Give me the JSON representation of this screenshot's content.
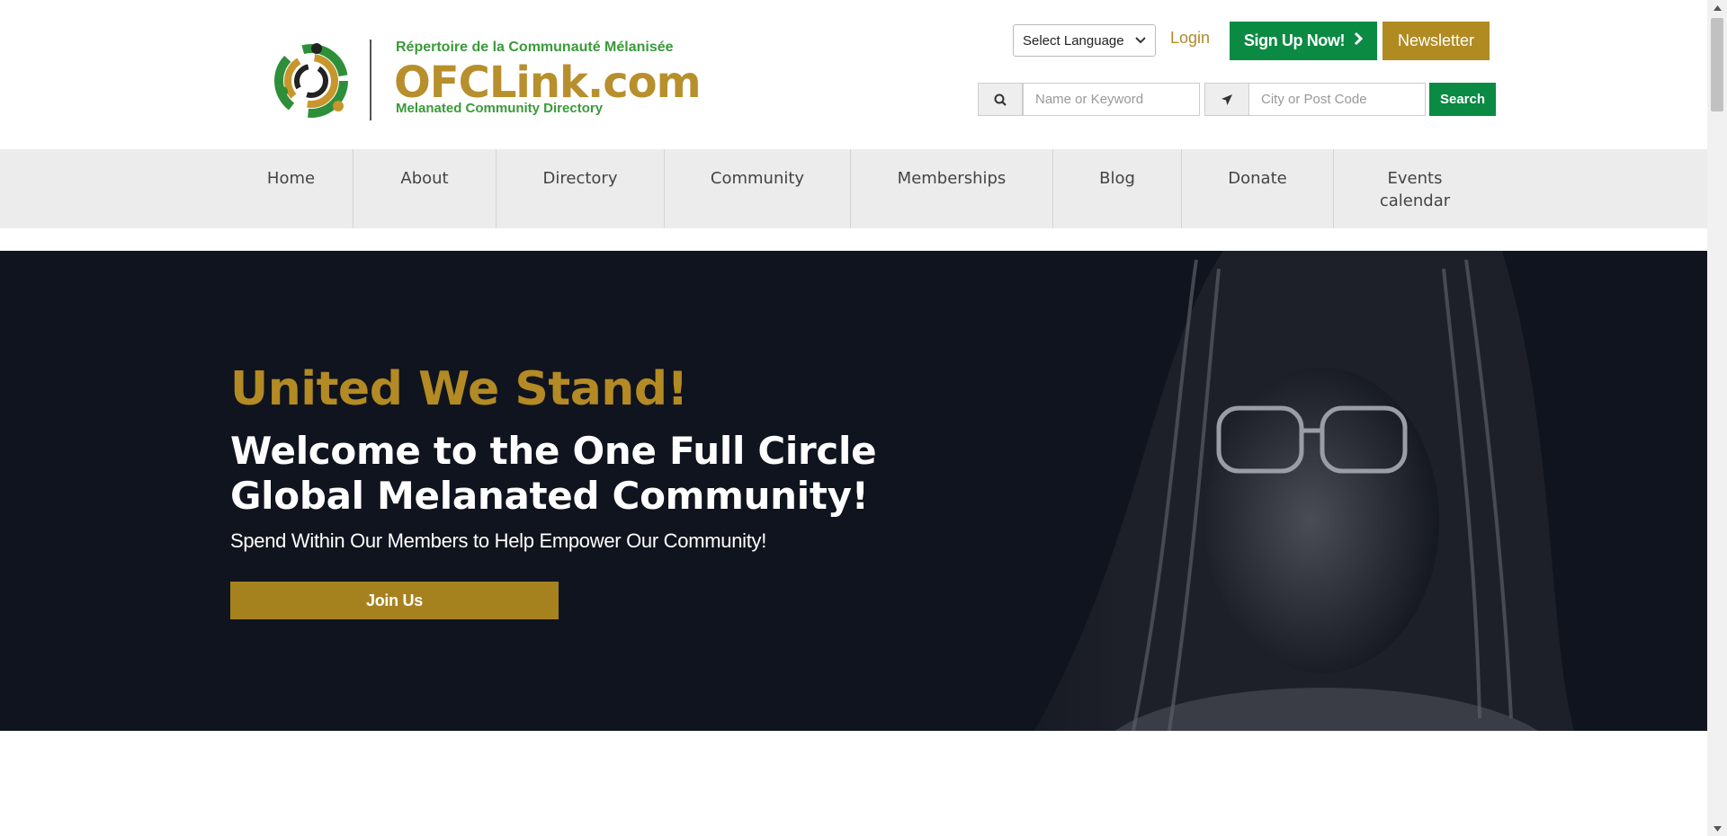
{
  "header": {
    "logo": {
      "top_text": "Répertoire de la Communauté Mélanisée",
      "main_text": "OFCLink.com",
      "bottom_text": "Melanated Community Directory"
    },
    "language_select": {
      "value": "Select Language"
    },
    "login_label": "Login",
    "signup_label": "Sign Up Now!",
    "newsletter_label": "Newsletter",
    "search": {
      "keyword_placeholder": "Name or Keyword",
      "location_placeholder": "City or Post Code",
      "button_label": "Search"
    }
  },
  "nav": {
    "items": [
      {
        "label": "Home"
      },
      {
        "label": "About"
      },
      {
        "label": "Directory"
      },
      {
        "label": "Community"
      },
      {
        "label": "Memberships"
      },
      {
        "label": "Blog"
      },
      {
        "label": "Donate"
      },
      {
        "label": "Events\ncalendar"
      }
    ]
  },
  "hero": {
    "tagline": "United We Stand!",
    "title": "Welcome to the One Full Circle Global Melanated Community!",
    "subtitle": "Spend Within Our Members to Help Empower Our Community!",
    "cta_label": "Join Us"
  },
  "colors": {
    "green": "#0a8a43",
    "gold": "#b08b22",
    "hero_bg": "#10141e",
    "nav_bg": "#ececec"
  },
  "icons": {
    "search_addon": "search-icon",
    "location_addon": "location-arrow-icon",
    "signup_chevron": "chevron-right-icon"
  }
}
